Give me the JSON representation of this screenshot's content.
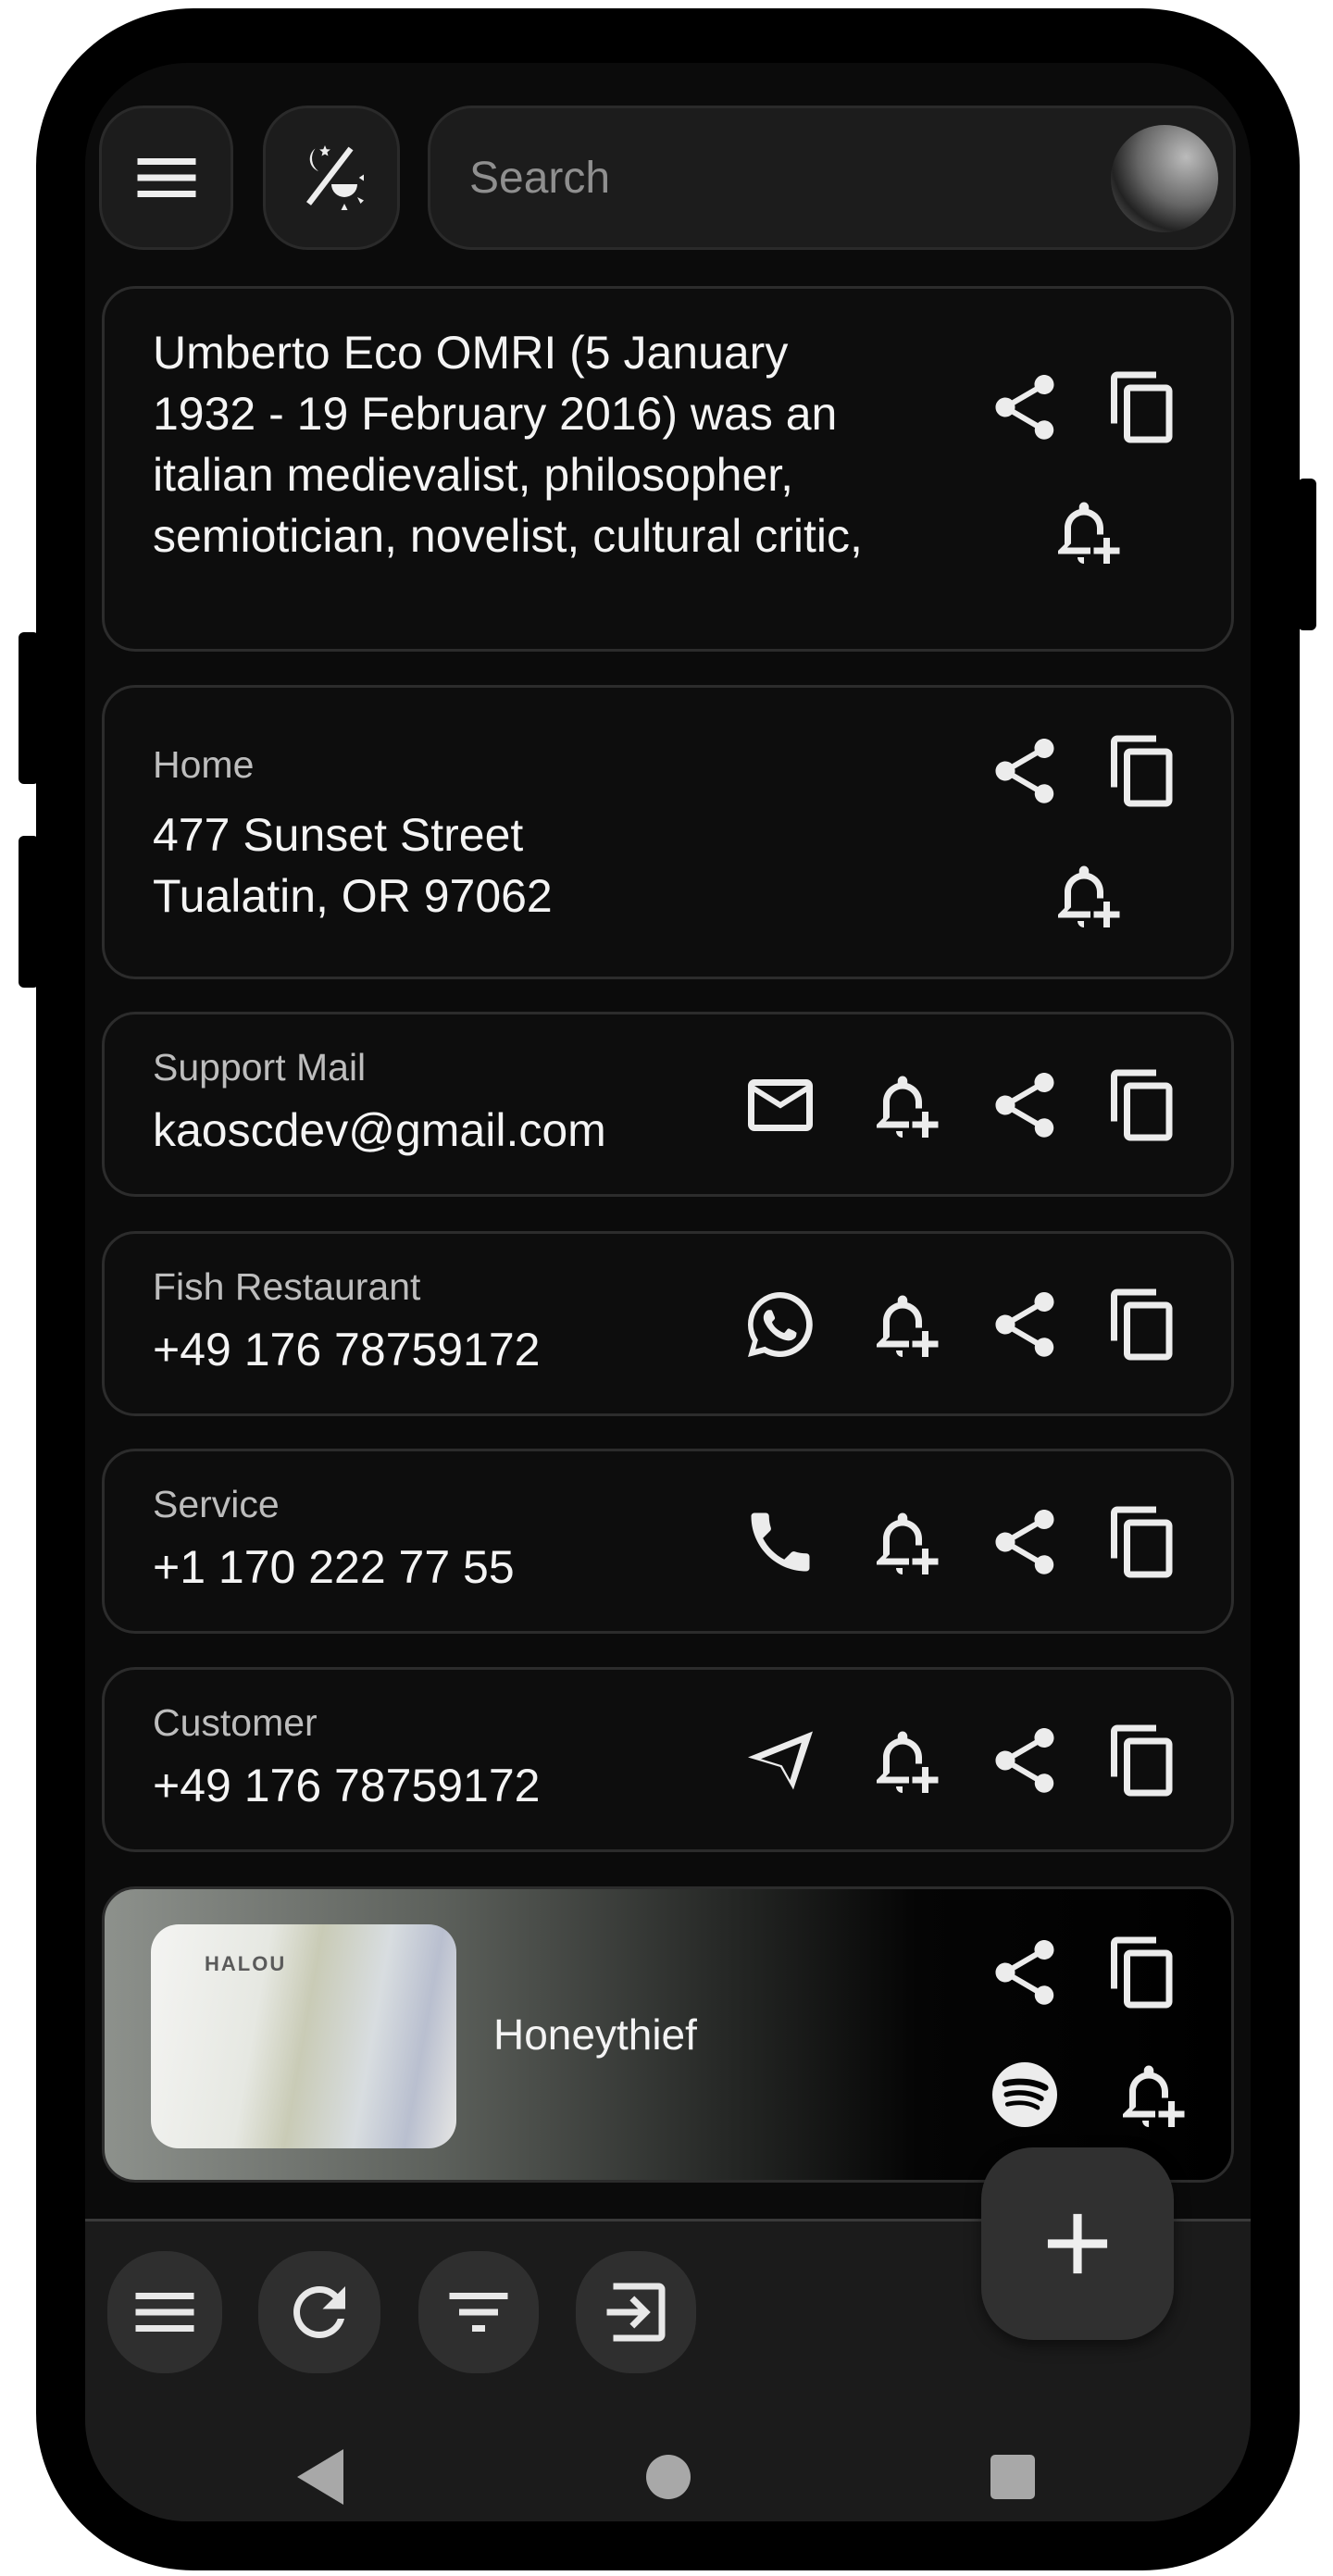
{
  "search": {
    "placeholder": "Search"
  },
  "cards": [
    {
      "type": "note",
      "text": "Umberto Eco OMRI (5 January 1932 - 19 February 2016) was an italian medievalist, philosopher, semiotician, novelist, cultural critic,",
      "icons": [
        "share-icon",
        "copy-icon",
        "bell-plus-icon"
      ]
    },
    {
      "type": "address",
      "label": "Home",
      "line1": "477 Sunset Street",
      "line2": "Tualatin, OR 97062",
      "icons": [
        "share-icon",
        "copy-icon",
        "bell-plus-icon"
      ]
    },
    {
      "type": "email",
      "label": "Support Mail",
      "value": "kaoscdev@gmail.com",
      "icons": [
        "mail-icon",
        "bell-plus-icon",
        "share-icon",
        "copy-icon"
      ]
    },
    {
      "type": "whatsapp",
      "label": "Fish Restaurant",
      "value": "+49 176 78759172",
      "icons": [
        "whatsapp-icon",
        "bell-plus-icon",
        "share-icon",
        "copy-icon"
      ]
    },
    {
      "type": "phone",
      "label": "Service",
      "value": "+1 170 222 77 55",
      "icons": [
        "phone-icon",
        "bell-plus-icon",
        "share-icon",
        "copy-icon"
      ]
    },
    {
      "type": "telegram",
      "label": "Customer",
      "value": "+49 176 78759172",
      "icons": [
        "telegram-icon",
        "bell-plus-icon",
        "share-icon",
        "copy-icon"
      ]
    },
    {
      "type": "music",
      "title": "Honeythief",
      "album_art_text": "HALOU",
      "icons": [
        "share-icon",
        "copy-icon",
        "spotify-icon",
        "bell-plus-icon"
      ]
    }
  ],
  "bottom_bar": {
    "buttons": [
      "menu-icon",
      "refresh-icon",
      "filter-icon",
      "import-icon"
    ]
  },
  "fab": "add-icon",
  "nav": [
    "back",
    "home",
    "recents"
  ]
}
